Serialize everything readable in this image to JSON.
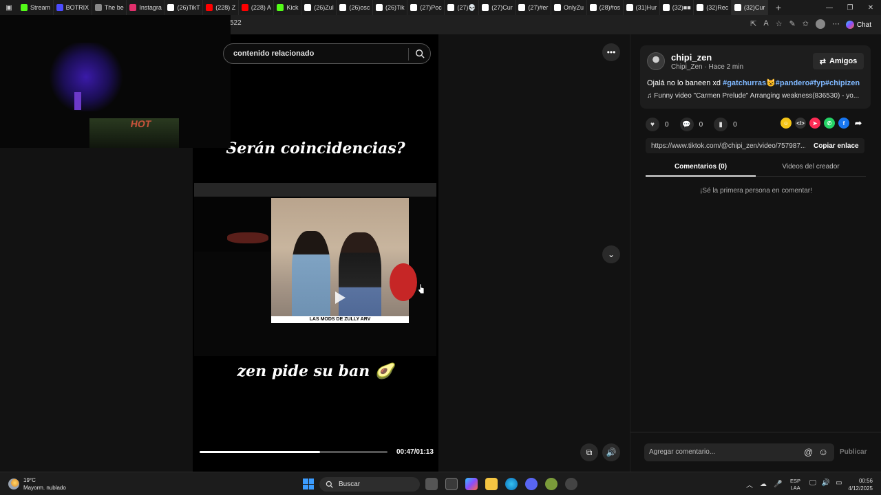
{
  "browser": {
    "tabs": [
      {
        "label": "Stream",
        "color": "#53fc18"
      },
      {
        "label": "BOTRIX",
        "color": "#4c4cff"
      },
      {
        "label": "The be",
        "color": "#888888"
      },
      {
        "label": "Instagra",
        "color": "#e1306c"
      },
      {
        "label": "(26)TikT",
        "color": "#ffffff"
      },
      {
        "label": "(228) Z",
        "color": "#ff0000"
      },
      {
        "label": "(228) A",
        "color": "#ff0000"
      },
      {
        "label": "Kick",
        "color": "#53fc18"
      },
      {
        "label": "(26)Zul",
        "color": "#ffffff"
      },
      {
        "label": "(26)osc",
        "color": "#ffffff"
      },
      {
        "label": "(26)Tik",
        "color": "#ffffff"
      },
      {
        "label": "(27)Poc",
        "color": "#ffffff"
      },
      {
        "label": "(27)💀",
        "color": "#ffffff"
      },
      {
        "label": "(27)Cur",
        "color": "#ffffff"
      },
      {
        "label": "(27)#er",
        "color": "#ffffff"
      },
      {
        "label": "OnlyZu",
        "color": "#ffffff"
      },
      {
        "label": "(28)#os",
        "color": "#ffffff"
      },
      {
        "label": "(31)Hur",
        "color": "#ffffff"
      },
      {
        "label": "(32)■■",
        "color": "#ffffff"
      },
      {
        "label": "(32)Rec",
        "color": "#ffffff"
      },
      {
        "label": "(32)Cur",
        "color": "#ffffff"
      }
    ],
    "url_fragment": "522",
    "chat_label": "Chat"
  },
  "search": {
    "label": "contenido relacionado"
  },
  "video": {
    "caption_top": "Serán coincidencias?",
    "caption_bottom": "zen pide su ban 🥑",
    "inner_caption": "LAS MODS DE ZULLY ARV",
    "progress_fraction": 0.64,
    "time": "00:47/01:13"
  },
  "post": {
    "username": "chipi_zen",
    "subline": "Chipi_Zen · Hace 2 min",
    "friends_button": "Amigos",
    "desc_text": "Ojalá no lo baneen xd ",
    "hashtag1": "#gatchurras",
    "hashtag_rest": "#pandero#fyp#chipizen",
    "music": "Funny video \"Carmen Prelude\" Arranging weakness(836530) - yo...",
    "likes": "0",
    "comments": "0",
    "saves": "0",
    "link": "https://www.tiktok.com/@chipi_zen/video/757987...",
    "copy_link": "Copiar enlace",
    "tab_comments": "Comentarios (0)",
    "tab_videos": "Videos del creador",
    "empty_text": "¡Sé la primera persona en comentar!",
    "comment_placeholder": "Agregar comentario...",
    "publish": "Publicar"
  },
  "taskbar": {
    "temp": "19°C",
    "weather": "Mayorm. nublado",
    "search": "Buscar",
    "lang1": "ESP",
    "lang2": "LAA",
    "time": "00:56",
    "date": "4/12/2025"
  }
}
